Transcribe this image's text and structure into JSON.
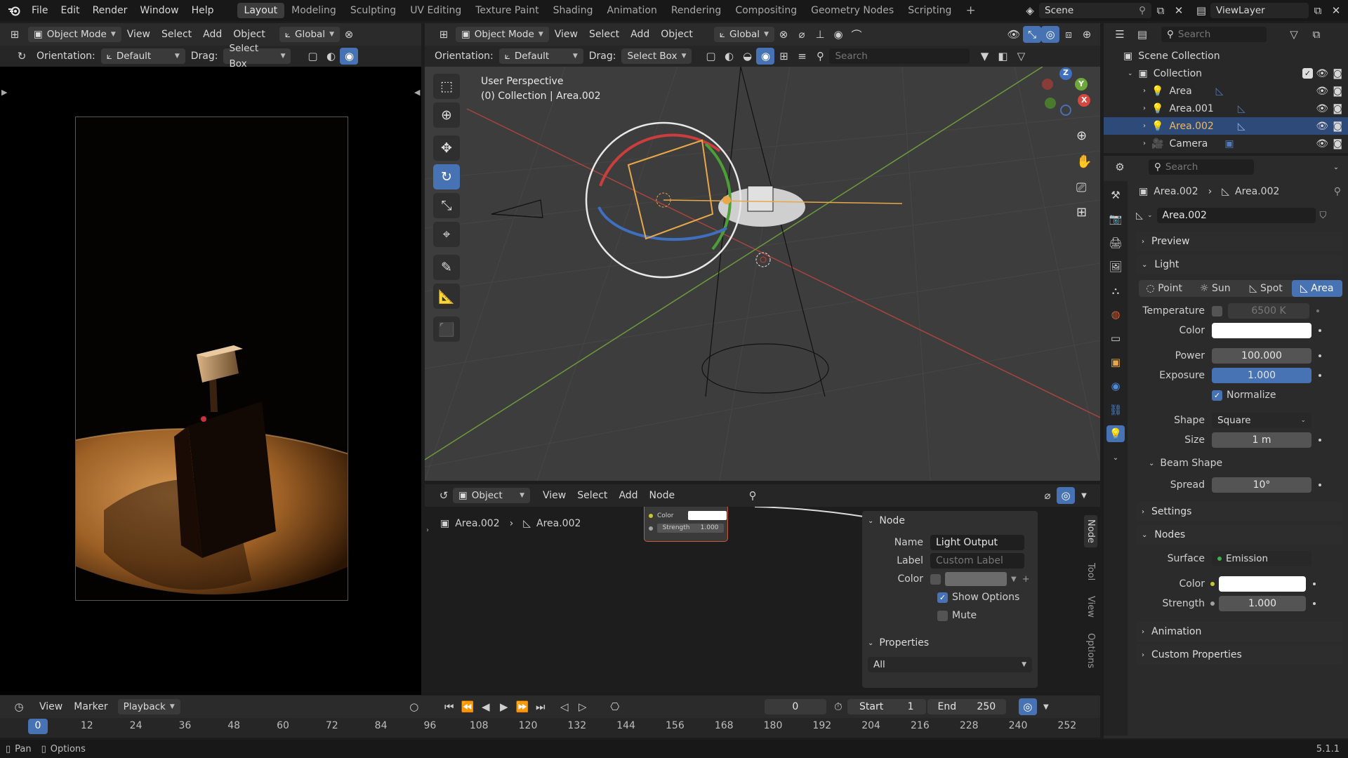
{
  "topbar": {
    "menu": [
      "File",
      "Edit",
      "Render",
      "Window",
      "Help"
    ],
    "workspaces": [
      "Layout",
      "Modeling",
      "Sculpting",
      "UV Editing",
      "Texture Paint",
      "Shading",
      "Animation",
      "Rendering",
      "Compositing",
      "Geometry Nodes",
      "Scripting"
    ],
    "active_workspace": "Layout",
    "add_workspace": "+",
    "scene": "Scene",
    "view_layer": "ViewLayer"
  },
  "left_viewport": {
    "mode": "Object Mode",
    "menus": [
      "View",
      "Select",
      "Add",
      "Object"
    ],
    "transform": "Global",
    "orientation_label": "Orientation:",
    "orientation": "Default",
    "drag_label": "Drag:",
    "drag": "Select Box"
  },
  "main_viewport": {
    "mode": "Object Mode",
    "menus": [
      "View",
      "Select",
      "Add",
      "Object"
    ],
    "transform": "Global",
    "orientation_label": "Orientation:",
    "orientation": "Default",
    "drag_label": "Drag:",
    "drag": "Select Box",
    "search_placeholder": "Search",
    "overlay_title": "User Perspective",
    "overlay_sub": "(0) Collection | Area.002",
    "gizmo": {
      "z": "Z",
      "y": "Y",
      "x": "X"
    }
  },
  "node_editor": {
    "type": "Object",
    "menus": [
      "View",
      "Select",
      "Add",
      "Node"
    ],
    "breadcrumb_obj": "Area.002",
    "breadcrumb_data": "Area.002",
    "node_socket_color": "Color",
    "node_socket_strength": "Strength",
    "node_strength_value": "1.000",
    "side_tabs": [
      "Node",
      "Tool",
      "View",
      "Options"
    ],
    "panel": {
      "node_header": "Node",
      "name_label": "Name",
      "name_value": "Light Output",
      "label_label": "Label",
      "label_placeholder": "Custom Label",
      "color_label": "Color",
      "show_options": "Show Options",
      "mute": "Mute",
      "properties_header": "Properties",
      "properties_value": "All"
    }
  },
  "outliner": {
    "search_placeholder": "Search",
    "scene_collection": "Scene Collection",
    "collection": "Collection",
    "items": [
      "Area",
      "Area.001",
      "Area.002",
      "Camera"
    ],
    "selected": "Area.002"
  },
  "properties": {
    "search_placeholder": "Search",
    "breadcrumb_obj": "Area.002",
    "breadcrumb_data": "Area.002",
    "datablock": "Area.002",
    "sections": {
      "preview": "Preview",
      "light": "Light",
      "beam_shape": "Beam Shape",
      "settings": "Settings",
      "nodes": "Nodes",
      "animation": "Animation",
      "custom_properties": "Custom Properties"
    },
    "light_types": [
      "Point",
      "Sun",
      "Spot",
      "Area"
    ],
    "active_light_type": "Area",
    "temperature_label": "Temperature",
    "temperature_value": "6500 K",
    "color_label": "Color",
    "power_label": "Power",
    "power_value": "100.000",
    "exposure_label": "Exposure",
    "exposure_value": "1.000",
    "normalize_label": "Normalize",
    "shape_label": "Shape",
    "shape_value": "Square",
    "size_label": "Size",
    "size_value": "1 m",
    "spread_label": "Spread",
    "spread_value": "10°",
    "surface_label": "Surface",
    "surface_value": "Emission",
    "node_color_label": "Color",
    "strength_label": "Strength",
    "strength_value": "1.000"
  },
  "timeline": {
    "menus": [
      "View",
      "Marker",
      "Playback"
    ],
    "current_frame": "0",
    "start_label": "Start",
    "start_value": "1",
    "end_label": "End",
    "end_value": "250",
    "ticks": [
      "0",
      "12",
      "24",
      "36",
      "48",
      "60",
      "72",
      "84",
      "96",
      "108",
      "120",
      "132",
      "144",
      "156",
      "168",
      "180",
      "192",
      "204",
      "216",
      "228",
      "240",
      "252"
    ]
  },
  "statusbar": {
    "pan": "Pan",
    "options": "Options",
    "version": "5.1.1"
  },
  "colors": {
    "accent": "#4772b3",
    "selected_row": "#2e4a78",
    "light_icon": "#e8a84a"
  }
}
